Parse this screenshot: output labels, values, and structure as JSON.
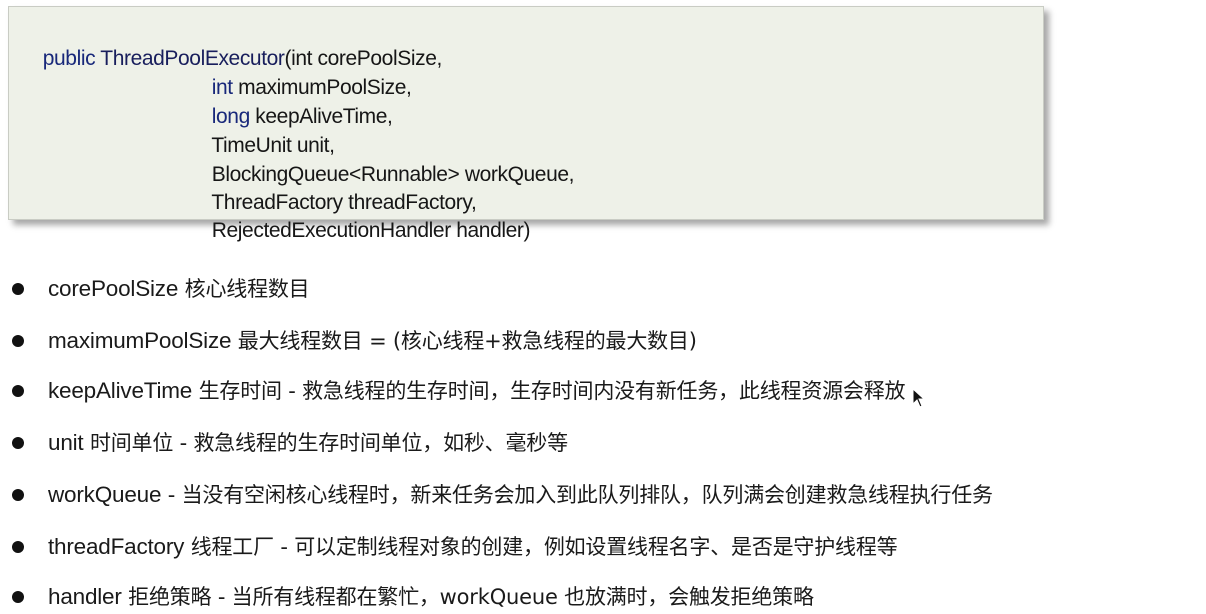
{
  "code": {
    "lines": [
      {
        "kw": "public ",
        "cls": "ThreadPoolExecutor",
        "rest": "(int corePoolSize,",
        "kw2": ""
      },
      {
        "kw": "int",
        "cls": "",
        "rest": " maximumPoolSize,"
      },
      {
        "kw": "long",
        "cls": "",
        "rest": " keepAliveTime,"
      },
      {
        "kw": "",
        "cls": "",
        "rest": "TimeUnit unit,"
      },
      {
        "kw": "",
        "cls": "",
        "rest": "BlockingQueue<Runnable> workQueue,"
      },
      {
        "kw": "",
        "cls": "",
        "rest": "ThreadFactory threadFactory,"
      },
      {
        "kw": "",
        "cls": "",
        "rest": "RejectedExecutionHandler handler)"
      }
    ]
  },
  "bullets": [
    {
      "term": "corePoolSize",
      "desc": " 核心线程数目"
    },
    {
      "term": "maximumPoolSize",
      "desc": " 最大线程数目 = (核心线程+救急线程的最大数目)"
    },
    {
      "term": "keepAliveTime",
      "desc": " 生存时间 - 救急线程的生存时间，生存时间内没有新任务，此线程资源会释放"
    },
    {
      "term": "unit",
      "desc": " 时间单位 - 救急线程的生存时间单位，如秒、毫秒等"
    },
    {
      "term": "workQueue",
      "desc": " - 当没有空闲核心线程时，新来任务会加入到此队列排队，队列满会创建救急线程执行任务"
    },
    {
      "term": "threadFactory",
      "desc": " 线程工厂 - 可以定制线程对象的创建，例如设置线程名字、是否是守护线程等"
    },
    {
      "term": "handler",
      "desc": " 拒绝策略 - 当所有线程都在繁忙，workQueue 也放满时，会触发拒绝策略"
    }
  ]
}
